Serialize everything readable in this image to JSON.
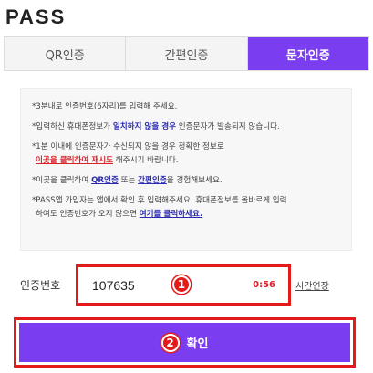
{
  "app": {
    "logo": "PASS"
  },
  "tabs": [
    {
      "label": "QR인증",
      "active": false
    },
    {
      "label": "간편인증",
      "active": false
    },
    {
      "label": "문자인증",
      "active": true
    }
  ],
  "notice": {
    "line1": "*3분내로 인증번호(6자리)를 입력해 주세요.",
    "line2_a": "*입력하신 휴대폰정보가 ",
    "line2_hl": "일치하지 않을 경우",
    "line2_b": " 인증문자가 발송되지 않습니다.",
    "line3_a": "*1분 이내에 인증문자가 수신되지 않을 경우 정확한 정보로",
    "line3_link": "이곳을 클릭하여 재시도",
    "line3_b": " 해주시기 바랍니다.",
    "line4_a": "*이곳을 클릭하여 ",
    "line4_link1": "QR인증",
    "line4_mid": " 또는 ",
    "line4_link2": "간편인증",
    "line4_b": "을 경험해보세요.",
    "line5_a": "*PASS앱 가입자는 앱에서 확인 후 입력해주세요. 휴대폰정보를 올바르게 입력",
    "line5_b": "하여도 인증번호가 오지 않으면 ",
    "line5_link": "여기를 클릭하세요."
  },
  "code": {
    "label": "인증번호",
    "value": "107635",
    "timer": "0:56",
    "extend_label": "시간연장",
    "badge": "1"
  },
  "confirm": {
    "label": "확인",
    "badge": "2"
  },
  "colors": {
    "accent": "#7b3df0",
    "highlight": "#e31a1a",
    "link": "#2a2ab0"
  }
}
